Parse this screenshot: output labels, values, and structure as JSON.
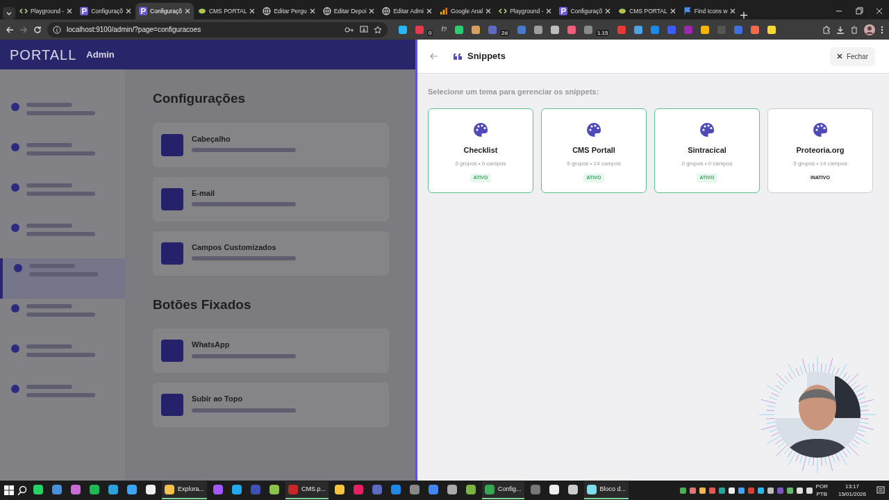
{
  "browser": {
    "tabs": [
      {
        "label": "Playground -",
        "kind": "code",
        "selected": false
      },
      {
        "label": "Configuraçõ",
        "kind": "plogo",
        "selected": false
      },
      {
        "label": "Configuraçõ",
        "kind": "plogo",
        "selected": true
      },
      {
        "label": "CMS PORTAL",
        "kind": "leaf",
        "selected": false
      },
      {
        "label": "Editar Pergu",
        "kind": "globe",
        "selected": false
      },
      {
        "label": "Editar Depoi",
        "kind": "globe",
        "selected": false
      },
      {
        "label": "Editar Admi",
        "kind": "globe",
        "selected": false
      },
      {
        "label": "Google Anal",
        "kind": "chart",
        "selected": false
      },
      {
        "label": "Playground -",
        "kind": "code",
        "selected": false
      },
      {
        "label": "Configuraçõ",
        "kind": "plogo",
        "selected": false
      },
      {
        "label": "CMS PORTAL",
        "kind": "leaf",
        "selected": false
      },
      {
        "label": "Find Icons w",
        "kind": "flag",
        "selected": false
      }
    ],
    "url": "localhost:9100/admin/?page=configuracoes",
    "extensions": [
      {
        "color": "#29b6f6"
      },
      {
        "color": "#e53950",
        "badge": "0"
      },
      {
        "glyph": "f?"
      },
      {
        "color": "#2ecc71"
      },
      {
        "color": "#d4a05a"
      },
      {
        "color": "#5c6bc0",
        "badge": "2d"
      },
      {
        "color": "#4a78c8"
      },
      {
        "color": "#9e9e9e"
      },
      {
        "color": "#bdbdbd"
      },
      {
        "color": "#ef5f7a"
      },
      {
        "color": "#8a8a8a",
        "badge": "1.15"
      },
      {
        "color": "#e53935"
      },
      {
        "color": "#4fa3e0"
      },
      {
        "color": "#1e88e5"
      },
      {
        "color": "#3d5afe"
      },
      {
        "color": "#9c27b0"
      },
      {
        "color": "#f4b400"
      },
      {
        "color": "#555555"
      },
      {
        "color": "#3f6fd8"
      },
      {
        "color": "#f26b4f"
      },
      {
        "color": "#f9d835"
      }
    ]
  },
  "app": {
    "brand": "PORTALL",
    "subtitle": "Admin",
    "sidebar": [
      {
        "selected": false
      },
      {
        "selected": false
      },
      {
        "selected": false
      },
      {
        "selected": false
      },
      {
        "selected": true
      },
      {
        "selected": false
      },
      {
        "selected": false
      },
      {
        "selected": false
      }
    ],
    "sections": [
      {
        "title": "Configurações",
        "cards": [
          {
            "title": "Cabeçalho"
          },
          {
            "title": "E-mail"
          },
          {
            "title": "Campos Customizados"
          }
        ]
      },
      {
        "title": "Botões Fixados",
        "cards": [
          {
            "title": "WhatsApp"
          },
          {
            "title": "Subir ao Topo"
          }
        ]
      }
    ]
  },
  "panel": {
    "title": "Snippets",
    "close": "Fechar",
    "prompt": "Selecione um tema para gerenciar os snippets:",
    "themes": [
      {
        "name": "Checklist",
        "meta": "0 grupos • 0 campos",
        "status": "ATIVO",
        "active": true
      },
      {
        "name": "CMS Portall",
        "meta": "5 grupos • 14 campos",
        "status": "ATIVO",
        "active": true
      },
      {
        "name": "Sintracical",
        "meta": "0 grupos • 0 campos",
        "status": "ATIVO",
        "active": true
      },
      {
        "name": "Proteoria.org",
        "meta": "5 grupos • 14 campos",
        "status": "INATIVO",
        "active": false
      }
    ]
  },
  "taskbar": {
    "apps": [
      {
        "color": "#25d366",
        "running": false
      },
      {
        "color": "#4a90d9",
        "running": false
      },
      {
        "color": "#c86dd7",
        "running": false
      },
      {
        "color": "#1db954",
        "running": false
      },
      {
        "color": "#2aa3df",
        "running": false
      },
      {
        "color": "#3da5f4",
        "running": false
      },
      {
        "color": "#eeeeee",
        "running": false
      },
      {
        "color": "#f2c14e",
        "label": "Explora...",
        "running": true
      },
      {
        "color": "#a259ff",
        "running": false
      },
      {
        "color": "#23a9f2",
        "running": false
      },
      {
        "color": "#3f51b5",
        "running": false
      },
      {
        "color": "#8bc34a",
        "running": false
      },
      {
        "color": "#c62828",
        "label": "CMS.p...",
        "running": true
      },
      {
        "color": "#f9c33c",
        "running": false
      },
      {
        "color": "#e91e63",
        "running": false
      },
      {
        "color": "#5c6bc0",
        "running": false
      },
      {
        "color": "#1e88e5",
        "running": false
      },
      {
        "color": "#888888",
        "running": false
      },
      {
        "color": "#4285f4",
        "running": false
      },
      {
        "color": "#aaaaaa",
        "running": false
      },
      {
        "color": "#7cb342",
        "running": false
      },
      {
        "color": "#34a853",
        "label": "Config...",
        "running": true
      },
      {
        "color": "#777777",
        "running": false
      },
      {
        "color": "#eeeeee",
        "running": false
      },
      {
        "color": "#cccccc",
        "running": false
      },
      {
        "color": "#80deea",
        "label": "Bloco d...",
        "running": true
      }
    ],
    "tray": [
      {
        "color": "#4caf50"
      },
      {
        "color": "#e57373"
      },
      {
        "color": "#ffb74d"
      },
      {
        "color": "#ef5350"
      },
      {
        "color": "#26a69a"
      },
      {
        "color": "#eeeeee"
      },
      {
        "color": "#42a5f5"
      },
      {
        "color": "#e53935"
      },
      {
        "color": "#29b6f6"
      },
      {
        "color": "#bdbdbd"
      },
      {
        "color": "#7e57c2"
      },
      {
        "color": "#66bb6a"
      },
      {
        "color": "#dddddd"
      },
      {
        "color": "#dddddd"
      }
    ],
    "lang": "POR",
    "layout": "PTB",
    "time": "13:17",
    "date": "15/01/2026"
  }
}
